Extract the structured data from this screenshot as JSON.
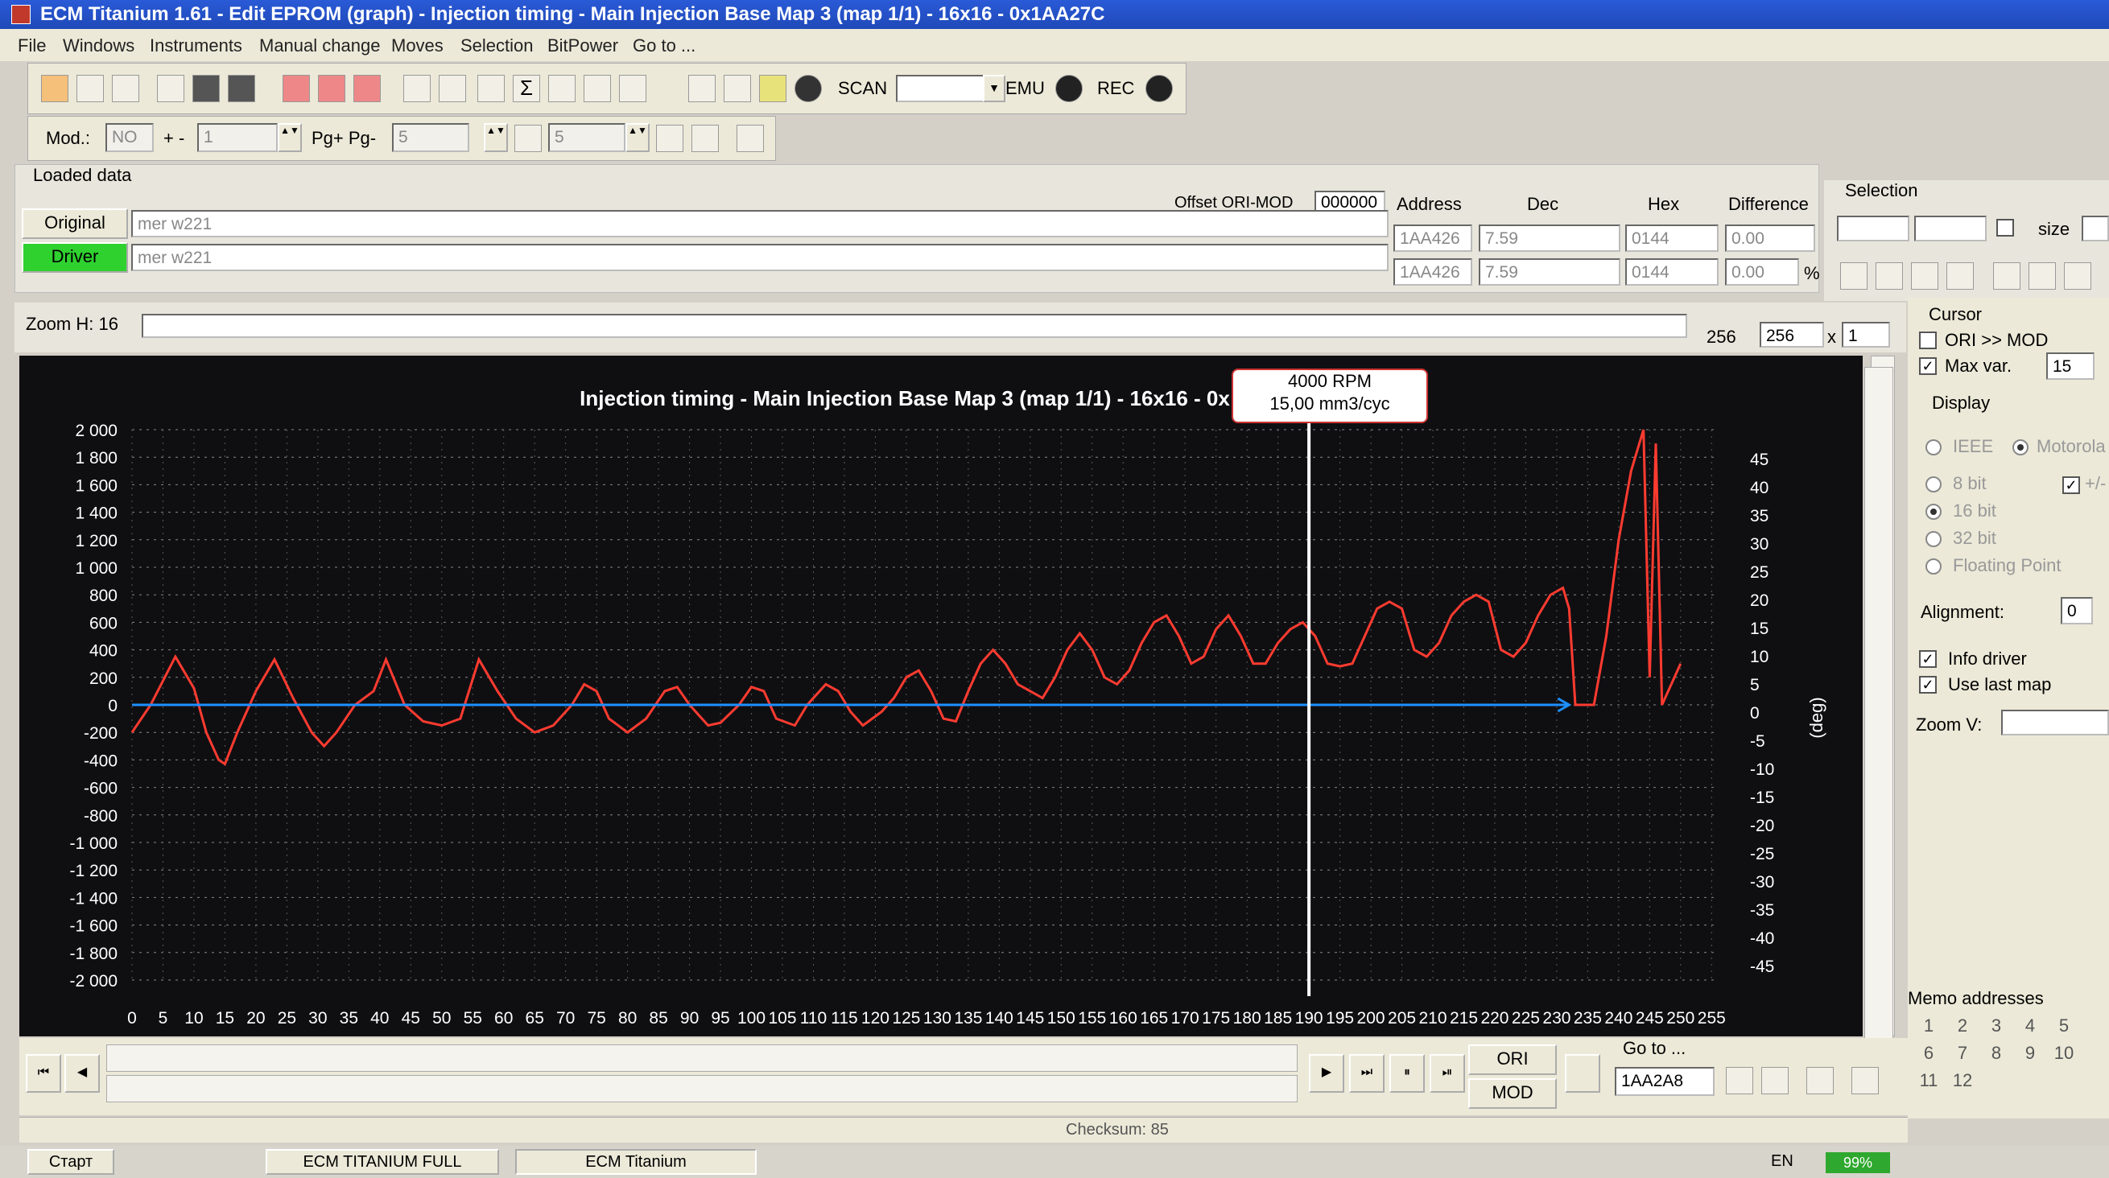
{
  "window": {
    "title": "ECM Titanium 1.61 - Edit EPROM (graph) - Injection timing - Main Injection Base Map 3 (map 1/1) - 16x16 - 0x1AA27C"
  },
  "menu": [
    "File",
    "Windows",
    "Instruments",
    "Manual change",
    "Moves",
    "Selection",
    "BitPower",
    "Go to ..."
  ],
  "toolbar": {
    "scan_label": "SCAN",
    "emu_label": "EMU",
    "rec_label": "REC",
    "scan_value": ""
  },
  "toolbar2": {
    "mod_label": "Mod.:",
    "mod_value": "NO",
    "plusminus_label": "+ -",
    "plusminus_value": "1",
    "pg_label": "Pg+ Pg-",
    "pg_value": "5",
    "step_value": "5"
  },
  "loaded": {
    "group_label": "Loaded data",
    "offset_label": "Offset ORI-MOD",
    "offset_value": "000000",
    "col_address": "Address",
    "col_dec": "Dec",
    "col_hex": "Hex",
    "col_diff": "Difference",
    "original_label": "Original",
    "original_file": "mer w221",
    "original_address": "1AA426",
    "original_dec": "7.59",
    "original_hex": "0144",
    "original_diff": "0.00",
    "driver_label": "Driver",
    "driver_file": "mer w221",
    "driver_address": "1AA426",
    "driver_dec": "7.59",
    "driver_hex": "0144",
    "driver_diff": "0.00",
    "percent": "%"
  },
  "selection": {
    "label": "Selection",
    "size_label": "size"
  },
  "zoom": {
    "label": "Zoom H: 16",
    "v1": "256",
    "v2": "256",
    "x_label": "x",
    "x_value": "1"
  },
  "cursor": {
    "label": "Cursor",
    "ori_mod": "ORI >> MOD",
    "maxvar_label": "Max var.",
    "maxvar_value": "15"
  },
  "display": {
    "label": "Display",
    "ieee": "IEEE",
    "motorola": "Motorola",
    "bit8": "8 bit",
    "bit16": "16 bit",
    "bit32": "32 bit",
    "float": "Floating Point",
    "plusminus": "+/-",
    "alignment_label": "Alignment:",
    "alignment_value": "0",
    "info_driver": "Info driver",
    "use_last_map": "Use last map",
    "zoomv_label": "Zoom V:"
  },
  "memo": {
    "label": "Memo addresses",
    "keys": [
      "1",
      "2",
      "3",
      "4",
      "5",
      "6",
      "7",
      "8",
      "9",
      "10",
      "11",
      "12"
    ]
  },
  "bottom": {
    "ori_label": "ORI",
    "mod_label": "MOD",
    "goto_label": "Go to ...",
    "goto_value": "1AA2A8",
    "checksum": "Checksum: 85"
  },
  "tooltip": {
    "line1": "4000 RPM",
    "line2": "15,00 mm3/cyc"
  },
  "chart_data": {
    "type": "line",
    "title": "Injection timing - Main Injection Base Map 3 (map 1/1) - 16x16 - 0x",
    "ylabel_right": "(deg)",
    "x_ticks": [
      0,
      5,
      10,
      15,
      20,
      25,
      30,
      35,
      40,
      45,
      50,
      55,
      60,
      65,
      70,
      75,
      80,
      85,
      90,
      95,
      100,
      105,
      110,
      115,
      120,
      125,
      130,
      135,
      140,
      145,
      150,
      155,
      160,
      165,
      170,
      175,
      180,
      185,
      190,
      195,
      200,
      205,
      210,
      215,
      220,
      225,
      230,
      235,
      240,
      245,
      250,
      255
    ],
    "y_left_ticks": [
      "2 000",
      "1 800",
      "1 600",
      "1 400",
      "1 200",
      "1 000",
      "800",
      "600",
      "400",
      "200",
      "0",
      "-200",
      "-400",
      "-600",
      "-800",
      "-1 000",
      "-1 200",
      "-1 400",
      "-1 600",
      "-1 800",
      "-2 000"
    ],
    "y_left_range": [
      -2000,
      2000
    ],
    "y_right_ticks": [
      "45",
      "40",
      "35",
      "30",
      "25",
      "20",
      "15",
      "10",
      "5",
      "0",
      "-5",
      "-10",
      "-15",
      "-20",
      "-25",
      "-30",
      "-35",
      "-40",
      "-45"
    ],
    "grid": true,
    "cursor_x": 190,
    "series": [
      {
        "color": "#ff3b30",
        "points": [
          [
            0,
            -200
          ],
          [
            3,
            0
          ],
          [
            7,
            350
          ],
          [
            10,
            120
          ],
          [
            12,
            -200
          ],
          [
            14,
            -400
          ],
          [
            15,
            -430
          ],
          [
            17,
            -200
          ],
          [
            20,
            100
          ],
          [
            23,
            330
          ],
          [
            26,
            50
          ],
          [
            29,
            -200
          ],
          [
            31,
            -300
          ],
          [
            33,
            -200
          ],
          [
            36,
            0
          ],
          [
            39,
            100
          ],
          [
            41,
            330
          ],
          [
            44,
            0
          ],
          [
            47,
            -120
          ],
          [
            50,
            -150
          ],
          [
            53,
            -100
          ],
          [
            56,
            330
          ],
          [
            59,
            100
          ],
          [
            62,
            -100
          ],
          [
            65,
            -200
          ],
          [
            68,
            -150
          ],
          [
            71,
            0
          ],
          [
            73,
            150
          ],
          [
            75,
            100
          ],
          [
            77,
            -100
          ],
          [
            80,
            -200
          ],
          [
            83,
            -100
          ],
          [
            86,
            100
          ],
          [
            88,
            130
          ],
          [
            90,
            0
          ],
          [
            93,
            -150
          ],
          [
            95,
            -130
          ],
          [
            98,
            0
          ],
          [
            100,
            130
          ],
          [
            102,
            100
          ],
          [
            104,
            -100
          ],
          [
            107,
            -150
          ],
          [
            109,
            0
          ],
          [
            112,
            150
          ],
          [
            114,
            100
          ],
          [
            116,
            -50
          ],
          [
            118,
            -150
          ],
          [
            121,
            -50
          ],
          [
            123,
            50
          ],
          [
            125,
            200
          ],
          [
            127,
            250
          ],
          [
            129,
            100
          ],
          [
            131,
            -100
          ],
          [
            133,
            -120
          ],
          [
            135,
            100
          ],
          [
            137,
            300
          ],
          [
            139,
            400
          ],
          [
            141,
            300
          ],
          [
            143,
            150
          ],
          [
            145,
            100
          ],
          [
            147,
            50
          ],
          [
            149,
            200
          ],
          [
            151,
            400
          ],
          [
            153,
            520
          ],
          [
            155,
            400
          ],
          [
            157,
            200
          ],
          [
            159,
            150
          ],
          [
            161,
            250
          ],
          [
            163,
            450
          ],
          [
            165,
            600
          ],
          [
            167,
            650
          ],
          [
            169,
            500
          ],
          [
            171,
            300
          ],
          [
            173,
            350
          ],
          [
            175,
            550
          ],
          [
            177,
            650
          ],
          [
            179,
            500
          ],
          [
            181,
            300
          ],
          [
            183,
            300
          ],
          [
            185,
            450
          ],
          [
            187,
            550
          ],
          [
            189,
            600
          ],
          [
            191,
            500
          ],
          [
            193,
            300
          ],
          [
            195,
            280
          ],
          [
            197,
            300
          ],
          [
            199,
            500
          ],
          [
            201,
            700
          ],
          [
            203,
            750
          ],
          [
            205,
            700
          ],
          [
            207,
            400
          ],
          [
            209,
            350
          ],
          [
            211,
            450
          ],
          [
            213,
            650
          ],
          [
            215,
            750
          ],
          [
            217,
            800
          ],
          [
            219,
            750
          ],
          [
            221,
            400
          ],
          [
            223,
            350
          ],
          [
            225,
            450
          ],
          [
            227,
            650
          ],
          [
            229,
            800
          ],
          [
            231,
            850
          ],
          [
            232,
            700
          ],
          [
            233,
            0
          ],
          [
            236,
            0
          ],
          [
            238,
            500
          ],
          [
            240,
            1200
          ],
          [
            242,
            1700
          ],
          [
            244,
            2000
          ],
          [
            245,
            200
          ],
          [
            246,
            1900
          ],
          [
            247,
            0
          ],
          [
            250,
            300
          ]
        ]
      },
      {
        "color": "#1e90ff",
        "points": [
          [
            0,
            0
          ],
          [
            232,
            0
          ]
        ]
      }
    ]
  },
  "taskbar": {
    "start_label": "Старт",
    "item1": "ECM TITANIUM FULL",
    "item2": "ECM Titanium",
    "lang": "EN",
    "battery": "99%"
  }
}
